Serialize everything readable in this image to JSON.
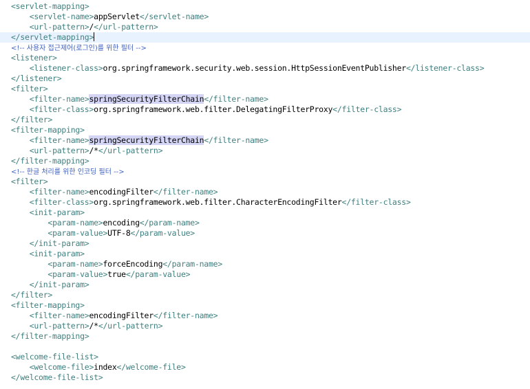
{
  "colors": {
    "tag": "#3f7f7f",
    "text": "#000000",
    "comment": "#3f5fbf",
    "highlight": "#d4d4f4",
    "current_line": "#e8f2fe"
  },
  "lines": [
    {
      "indent": 0,
      "parts": [
        {
          "t": "tag",
          "v": "<servlet-mapping>"
        }
      ]
    },
    {
      "indent": 1,
      "parts": [
        {
          "t": "tag",
          "v": "<servlet-name>"
        },
        {
          "t": "text",
          "v": "appServlet"
        },
        {
          "t": "tag",
          "v": "</servlet-name>"
        }
      ]
    },
    {
      "indent": 1,
      "parts": [
        {
          "t": "tag",
          "v": "<url-pattern>"
        },
        {
          "t": "text",
          "v": "/"
        },
        {
          "t": "tag",
          "v": "</url-pattern>"
        }
      ]
    },
    {
      "indent": 0,
      "current": true,
      "parts": [
        {
          "t": "tag",
          "v": "</servlet-mapping>"
        },
        {
          "t": "caret",
          "v": ""
        }
      ]
    },
    {
      "indent": 0,
      "parts": [
        {
          "t": "comment",
          "v": "<!-- 사용자 접근제어(로그인)를 위한 필터 -->"
        }
      ]
    },
    {
      "indent": 0,
      "parts": [
        {
          "t": "tag",
          "v": "<listener>"
        }
      ]
    },
    {
      "indent": 1,
      "parts": [
        {
          "t": "tag",
          "v": "<listener-class>"
        },
        {
          "t": "text",
          "v": "org.springframework.security.web.session.HttpSessionEventPublisher"
        },
        {
          "t": "tag",
          "v": "</listener-class>"
        }
      ]
    },
    {
      "indent": 0,
      "parts": [
        {
          "t": "tag",
          "v": "</listener>"
        }
      ]
    },
    {
      "indent": 0,
      "parts": [
        {
          "t": "tag",
          "v": "<filter>"
        }
      ]
    },
    {
      "indent": 1,
      "parts": [
        {
          "t": "tag",
          "v": "<filter-name>"
        },
        {
          "t": "hl",
          "v": "springSecurityFilterChain"
        },
        {
          "t": "tag",
          "v": "</filter-name>"
        }
      ]
    },
    {
      "indent": 1,
      "parts": [
        {
          "t": "tag",
          "v": "<filter-class>"
        },
        {
          "t": "text",
          "v": "org.springframework.web.filter.DelegatingFilterProxy"
        },
        {
          "t": "tag",
          "v": "</filter-class>"
        }
      ]
    },
    {
      "indent": 0,
      "parts": [
        {
          "t": "tag",
          "v": "</filter>"
        }
      ]
    },
    {
      "indent": 0,
      "parts": [
        {
          "t": "tag",
          "v": "<filter-mapping>"
        }
      ]
    },
    {
      "indent": 1,
      "parts": [
        {
          "t": "tag",
          "v": "<filter-name>"
        },
        {
          "t": "hl",
          "v": "springSecurityFilterChain"
        },
        {
          "t": "tag",
          "v": "</filter-name>"
        }
      ]
    },
    {
      "indent": 1,
      "parts": [
        {
          "t": "tag",
          "v": "<url-pattern>"
        },
        {
          "t": "text",
          "v": "/*"
        },
        {
          "t": "tag",
          "v": "</url-pattern>"
        }
      ]
    },
    {
      "indent": 0,
      "parts": [
        {
          "t": "tag",
          "v": "</filter-mapping>"
        }
      ]
    },
    {
      "indent": 0,
      "parts": [
        {
          "t": "comment",
          "v": "<!-- 한글 처리를 위한 인코딩 필터 -->"
        }
      ]
    },
    {
      "indent": 0,
      "parts": [
        {
          "t": "tag",
          "v": "<filter>"
        }
      ]
    },
    {
      "indent": 1,
      "parts": [
        {
          "t": "tag",
          "v": "<filter-name>"
        },
        {
          "t": "text",
          "v": "encodingFilter"
        },
        {
          "t": "tag",
          "v": "</filter-name>"
        }
      ]
    },
    {
      "indent": 1,
      "parts": [
        {
          "t": "tag",
          "v": "<filter-class>"
        },
        {
          "t": "text",
          "v": "org.springframework.web.filter.CharacterEncodingFilter"
        },
        {
          "t": "tag",
          "v": "</filter-class>"
        }
      ]
    },
    {
      "indent": 1,
      "parts": [
        {
          "t": "tag",
          "v": "<init-param>"
        }
      ]
    },
    {
      "indent": 2,
      "parts": [
        {
          "t": "tag",
          "v": "<param-name>"
        },
        {
          "t": "text",
          "v": "encoding"
        },
        {
          "t": "tag",
          "v": "</param-name>"
        }
      ]
    },
    {
      "indent": 2,
      "parts": [
        {
          "t": "tag",
          "v": "<param-value>"
        },
        {
          "t": "text",
          "v": "UTF-8"
        },
        {
          "t": "tag",
          "v": "</param-value>"
        }
      ]
    },
    {
      "indent": 1,
      "parts": [
        {
          "t": "tag",
          "v": "</init-param>"
        }
      ]
    },
    {
      "indent": 1,
      "parts": [
        {
          "t": "tag",
          "v": "<init-param>"
        }
      ]
    },
    {
      "indent": 2,
      "parts": [
        {
          "t": "tag",
          "v": "<param-name>"
        },
        {
          "t": "text",
          "v": "forceEncoding"
        },
        {
          "t": "tag",
          "v": "</param-name>"
        }
      ]
    },
    {
      "indent": 2,
      "parts": [
        {
          "t": "tag",
          "v": "<param-value>"
        },
        {
          "t": "text",
          "v": "true"
        },
        {
          "t": "tag",
          "v": "</param-value>"
        }
      ]
    },
    {
      "indent": 1,
      "parts": [
        {
          "t": "tag",
          "v": "</init-param>"
        }
      ]
    },
    {
      "indent": 0,
      "parts": [
        {
          "t": "tag",
          "v": "</filter>"
        }
      ]
    },
    {
      "indent": 0,
      "parts": [
        {
          "t": "tag",
          "v": "<filter-mapping>"
        }
      ]
    },
    {
      "indent": 1,
      "parts": [
        {
          "t": "tag",
          "v": "<filter-name>"
        },
        {
          "t": "text",
          "v": "encodingFilter"
        },
        {
          "t": "tag",
          "v": "</filter-name>"
        }
      ]
    },
    {
      "indent": 1,
      "parts": [
        {
          "t": "tag",
          "v": "<url-pattern>"
        },
        {
          "t": "text",
          "v": "/*"
        },
        {
          "t": "tag",
          "v": "</url-pattern>"
        }
      ]
    },
    {
      "indent": 0,
      "parts": [
        {
          "t": "tag",
          "v": "</filter-mapping>"
        }
      ]
    },
    {
      "indent": 0,
      "parts": []
    },
    {
      "indent": 0,
      "parts": [
        {
          "t": "tag",
          "v": "<welcome-file-list>"
        }
      ]
    },
    {
      "indent": 1,
      "parts": [
        {
          "t": "tag",
          "v": "<welcome-file>"
        },
        {
          "t": "text",
          "v": "index"
        },
        {
          "t": "tag",
          "v": "</welcome-file>"
        }
      ]
    },
    {
      "indent": 0,
      "parts": [
        {
          "t": "tag",
          "v": "</welcome-file-list>"
        }
      ]
    }
  ]
}
